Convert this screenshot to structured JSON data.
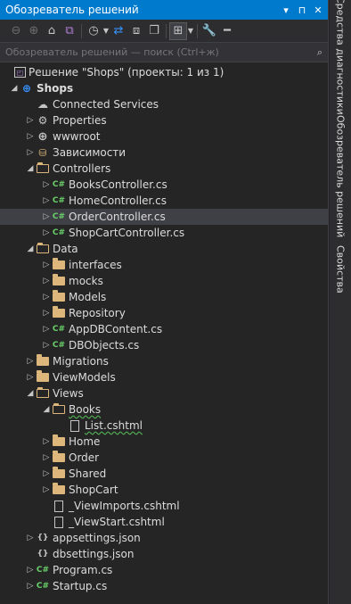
{
  "window": {
    "title": "Обозреватель решений",
    "pin_glyph": "▾",
    "dock_glyph": "⊓",
    "close_glyph": "✕"
  },
  "search": {
    "placeholder": "Обозреватель решений — поиск (Ctrl+ж)"
  },
  "toolbar": {
    "icons": [
      "back-icon",
      "forward-icon",
      "home-icon",
      "vs-icon",
      "history-icon",
      "sync-icon",
      "collapse-icon",
      "copy-icon",
      "show-all-icon",
      "properties-icon",
      "minus-icon"
    ]
  },
  "tree": {
    "solution": "Решение \"Shops\" (проекты: 1 из 1)",
    "project": "Shops",
    "connected": "Connected Services",
    "properties": "Properties",
    "wwwroot": "wwwroot",
    "deps": "Зависимости",
    "controllers": "Controllers",
    "controllers_items": [
      "BooksController.cs",
      "HomeController.cs",
      "OrderController.cs",
      "ShopCartController.cs"
    ],
    "data": "Data",
    "data_folders": [
      "interfaces",
      "mocks",
      "Models",
      "Repository"
    ],
    "data_files": [
      "AppDBContent.cs",
      "DBObjects.cs"
    ],
    "migrations": "Migrations",
    "viewmodels": "ViewModels",
    "views": "Views",
    "books": "Books",
    "list": "List.cshtml",
    "views_folders": [
      "Home",
      "Order",
      "Shared",
      "ShopCart"
    ],
    "view_imports": "_ViewImports.cshtml",
    "view_start": "_ViewStart.cshtml",
    "appsettings": "appsettings.json",
    "dbsettings": "dbsettings.json",
    "program": "Program.cs",
    "startup": "Startup.cs"
  },
  "side_tabs": [
    "Средства диагностики",
    "Обозреватель решений",
    "Свойства"
  ],
  "colors": {
    "accent": "#007acc",
    "background": "#252526",
    "folder": "#dcb67a",
    "csharp": "#6ad06a",
    "selection": "#3f3f46"
  }
}
